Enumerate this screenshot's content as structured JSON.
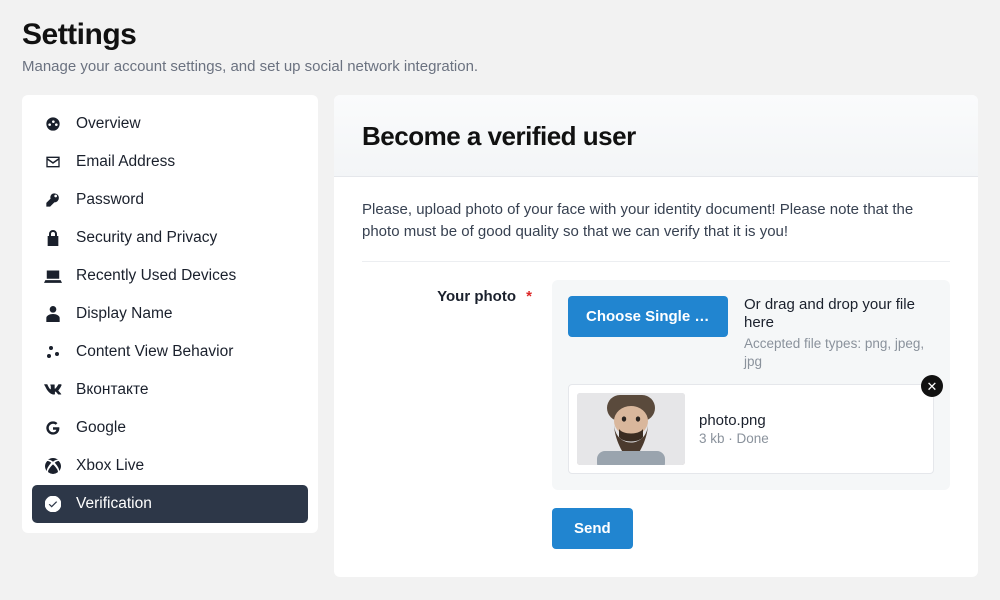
{
  "header": {
    "title": "Settings",
    "subtitle": "Manage your account settings, and set up social network integration."
  },
  "sidebar": {
    "items": [
      {
        "icon": "dashboard-icon",
        "label": "Overview"
      },
      {
        "icon": "envelope-icon",
        "label": "Email Address"
      },
      {
        "icon": "key-icon",
        "label": "Password"
      },
      {
        "icon": "lock-icon",
        "label": "Security and Privacy"
      },
      {
        "icon": "laptop-icon",
        "label": "Recently Used Devices"
      },
      {
        "icon": "user-icon",
        "label": "Display Name"
      },
      {
        "icon": "cogs-icon",
        "label": "Content View Behavior"
      },
      {
        "icon": "vk-icon",
        "label": "Вконтакте"
      },
      {
        "icon": "google-icon",
        "label": "Google"
      },
      {
        "icon": "xbox-icon",
        "label": "Xbox Live"
      },
      {
        "icon": "check-circle-icon",
        "label": "Verification",
        "active": true
      }
    ]
  },
  "main": {
    "heading": "Become a verified user",
    "instructions": "Please, upload photo of your face with your identity document! Please note that the photo must be of good quality so that we can verify that it is you!",
    "form": {
      "photo_label": "Your photo",
      "required_mark": "*",
      "choose_button_label": "Choose Single Fi...",
      "drag_title": "Or drag and drop your file here",
      "drag_sub": "Accepted file types: png, jpeg, jpg",
      "file": {
        "name": "photo.png",
        "meta": "3 kb · Done"
      },
      "send_label": "Send"
    }
  },
  "colors": {
    "primary": "#2185d0",
    "sidebar_active_bg": "#2d3748"
  }
}
